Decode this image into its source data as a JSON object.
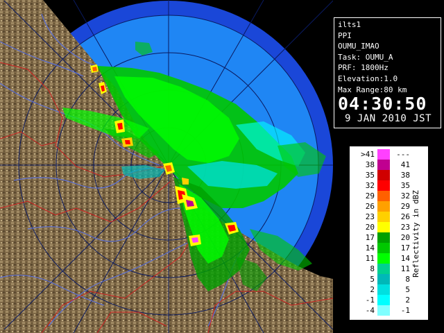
{
  "info": {
    "lines": [
      "ilts1",
      "PPI",
      "OUMU_IMAO",
      "Task: OUMU_A",
      "PRF: 1800Hz",
      "Elevation:1.0",
      "Max Range:80 km"
    ],
    "time": "04:30:50",
    "date": "9 JAN 2010 JST"
  },
  "legend": {
    "title": "Reflectivity in dBZ",
    "rows": [
      {
        "lo": ">41",
        "hi": "---",
        "color": "#ff40ff"
      },
      {
        "lo": "38",
        "hi": "41",
        "color": "#c00090"
      },
      {
        "lo": "35",
        "hi": "38",
        "color": "#d00000"
      },
      {
        "lo": "32",
        "hi": "35",
        "color": "#ff0000"
      },
      {
        "lo": "29",
        "hi": "32",
        "color": "#ff6000"
      },
      {
        "lo": "26",
        "hi": "29",
        "color": "#ffa000"
      },
      {
        "lo": "23",
        "hi": "26",
        "color": "#ffd000"
      },
      {
        "lo": "20",
        "hi": "23",
        "color": "#ffff00"
      },
      {
        "lo": "17",
        "hi": "20",
        "color": "#00a000"
      },
      {
        "lo": "14",
        "hi": "17",
        "color": "#00c800"
      },
      {
        "lo": "11",
        "hi": "14",
        "color": "#00ff00"
      },
      {
        "lo": "8",
        "hi": "11",
        "color": "#00d090"
      },
      {
        "lo": "5",
        "hi": "8",
        "color": "#00b8b8"
      },
      {
        "lo": "2",
        "hi": "5",
        "color": "#00e0e0"
      },
      {
        "lo": "-1",
        "hi": "2",
        "color": "#00ffff"
      },
      {
        "lo": "-4",
        "hi": "-1",
        "color": "#80ffff"
      }
    ]
  },
  "map": {
    "colors": {
      "range_outer": "#1a47d8",
      "range_inner": "#1f86f4",
      "land": "#7e6847",
      "boundary": "#d02020",
      "river": "#5a6fd6",
      "ring": "#0a1a60"
    }
  }
}
